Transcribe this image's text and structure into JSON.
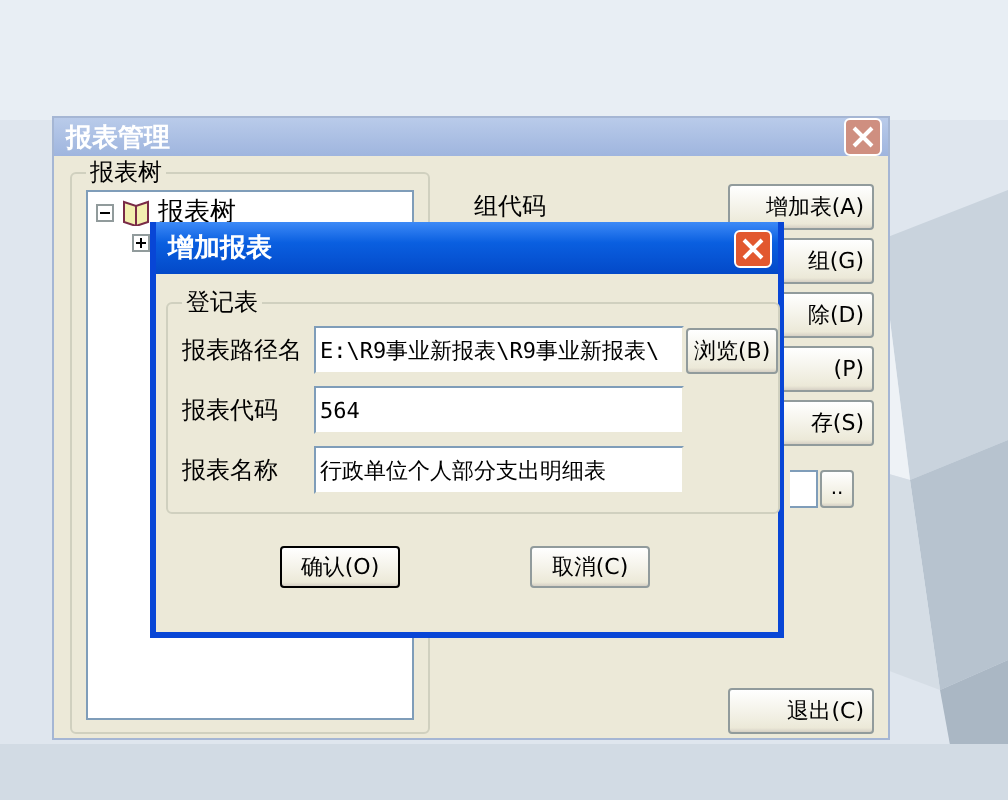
{
  "main_window": {
    "title": "报表管理",
    "tree_group": {
      "title": "报表树",
      "tree": [
        {
          "label": "报表树",
          "expanded": true,
          "children": [
            {
              "expanded": false
            }
          ]
        }
      ]
    },
    "group_code_label": "组代码",
    "buttons": [
      "增加表(A)",
      "组(G)",
      "除(D)",
      "(P)",
      "存(S)"
    ],
    "browse_small": "..",
    "exit_button": "退出(C)"
  },
  "dialog": {
    "title": "增加报表",
    "group_title": "登记表",
    "fields": [
      {
        "label": "报表路径名",
        "value": "E:\\R9事业新报表\\R9事业新报表\\"
      },
      {
        "label": "报表代码",
        "value": "564"
      },
      {
        "label": "报表名称",
        "value": "行政单位个人部分支出明细表"
      }
    ],
    "browse_button": "浏览(B)",
    "buttons": [
      {
        "label": "确认(O)",
        "selected": true
      },
      {
        "label": "取消(C)",
        "selected": false
      }
    ]
  }
}
